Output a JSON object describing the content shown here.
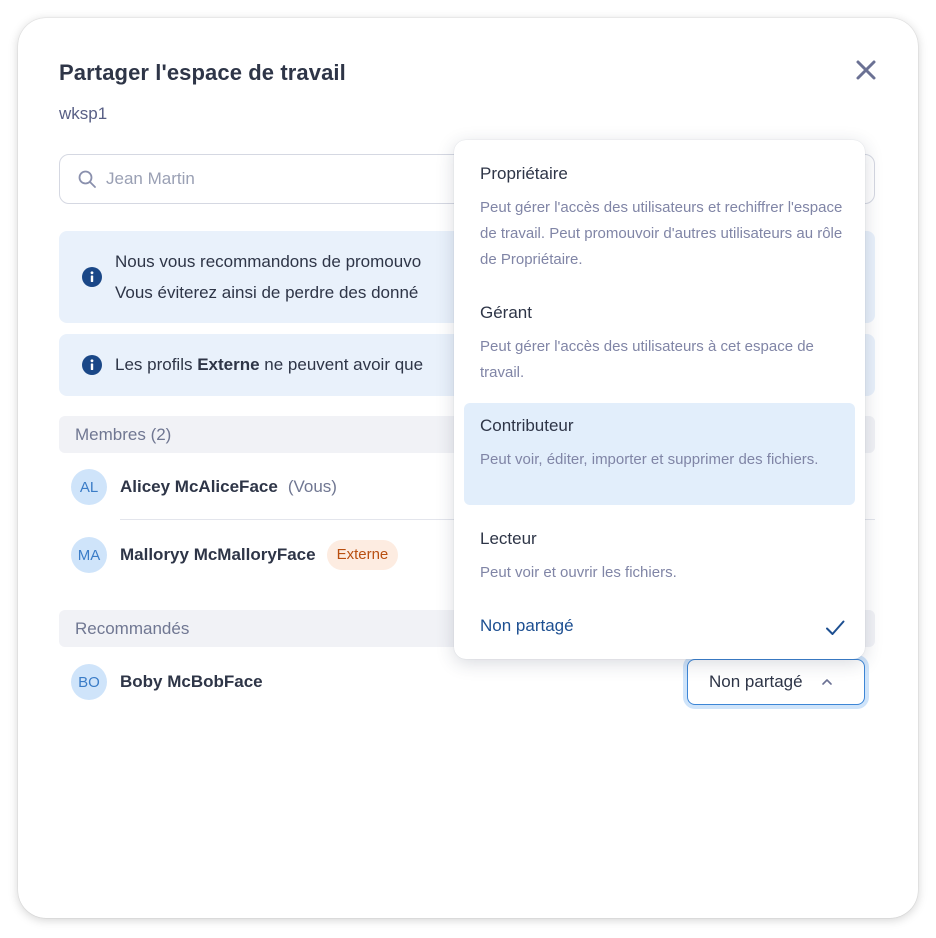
{
  "dialog": {
    "title": "Partager l'espace de travail",
    "workspace_name": "wksp1",
    "close_icon": "close-icon"
  },
  "search": {
    "placeholder": "Jean Martin",
    "value": "",
    "icon": "search-icon"
  },
  "info_banners": [
    {
      "icon": "info-icon",
      "line1": "Nous vous recommandons de promouvo",
      "line2": "Vous éviterez ainsi de perdre des donné"
    },
    {
      "icon": "info-icon",
      "text_before": "Les profils ",
      "text_bold": "Externe",
      "text_after": " ne peuvent avoir que"
    }
  ],
  "members": {
    "header": "Membres (2)",
    "items": [
      {
        "initials": "AL",
        "name": "Alicey McAliceFace",
        "suffix": "(Vous)"
      },
      {
        "initials": "MA",
        "name": "Malloryy McMalloryFace",
        "badge": "Externe"
      }
    ]
  },
  "recommended": {
    "header": "Recommandés",
    "items": [
      {
        "initials": "BO",
        "name": "Boby McBobFace",
        "role": "Non partagé"
      }
    ]
  },
  "role_dropdown": {
    "selected": "Non partagé",
    "options": [
      {
        "title": "Propriétaire",
        "description": "Peut gérer l'accès des utilisateurs et rechiffrer l'espace de travail. Peut promouvoir d'autres utilisateurs au rôle de Propriétaire."
      },
      {
        "title": "Gérant",
        "description": "Peut gérer l'accès des utilisateurs à cet espace de travail."
      },
      {
        "title": "Contributeur",
        "description": "Peut voir, éditer, importer et supprimer des fichiers.",
        "highlighted": true
      },
      {
        "title": "Lecteur",
        "description": "Peut voir et ouvrir les fichiers."
      },
      {
        "title": "Non partagé",
        "selected": true
      }
    ]
  },
  "colors": {
    "accent": "#3d86d6",
    "info_bg": "#e9f1fb",
    "highlight_bg": "#e2eefb",
    "badge_bg": "#fdece1",
    "badge_text": "#b94f10",
    "avatar_bg": "#cfe4fa",
    "selected_text": "#1d4f91"
  }
}
